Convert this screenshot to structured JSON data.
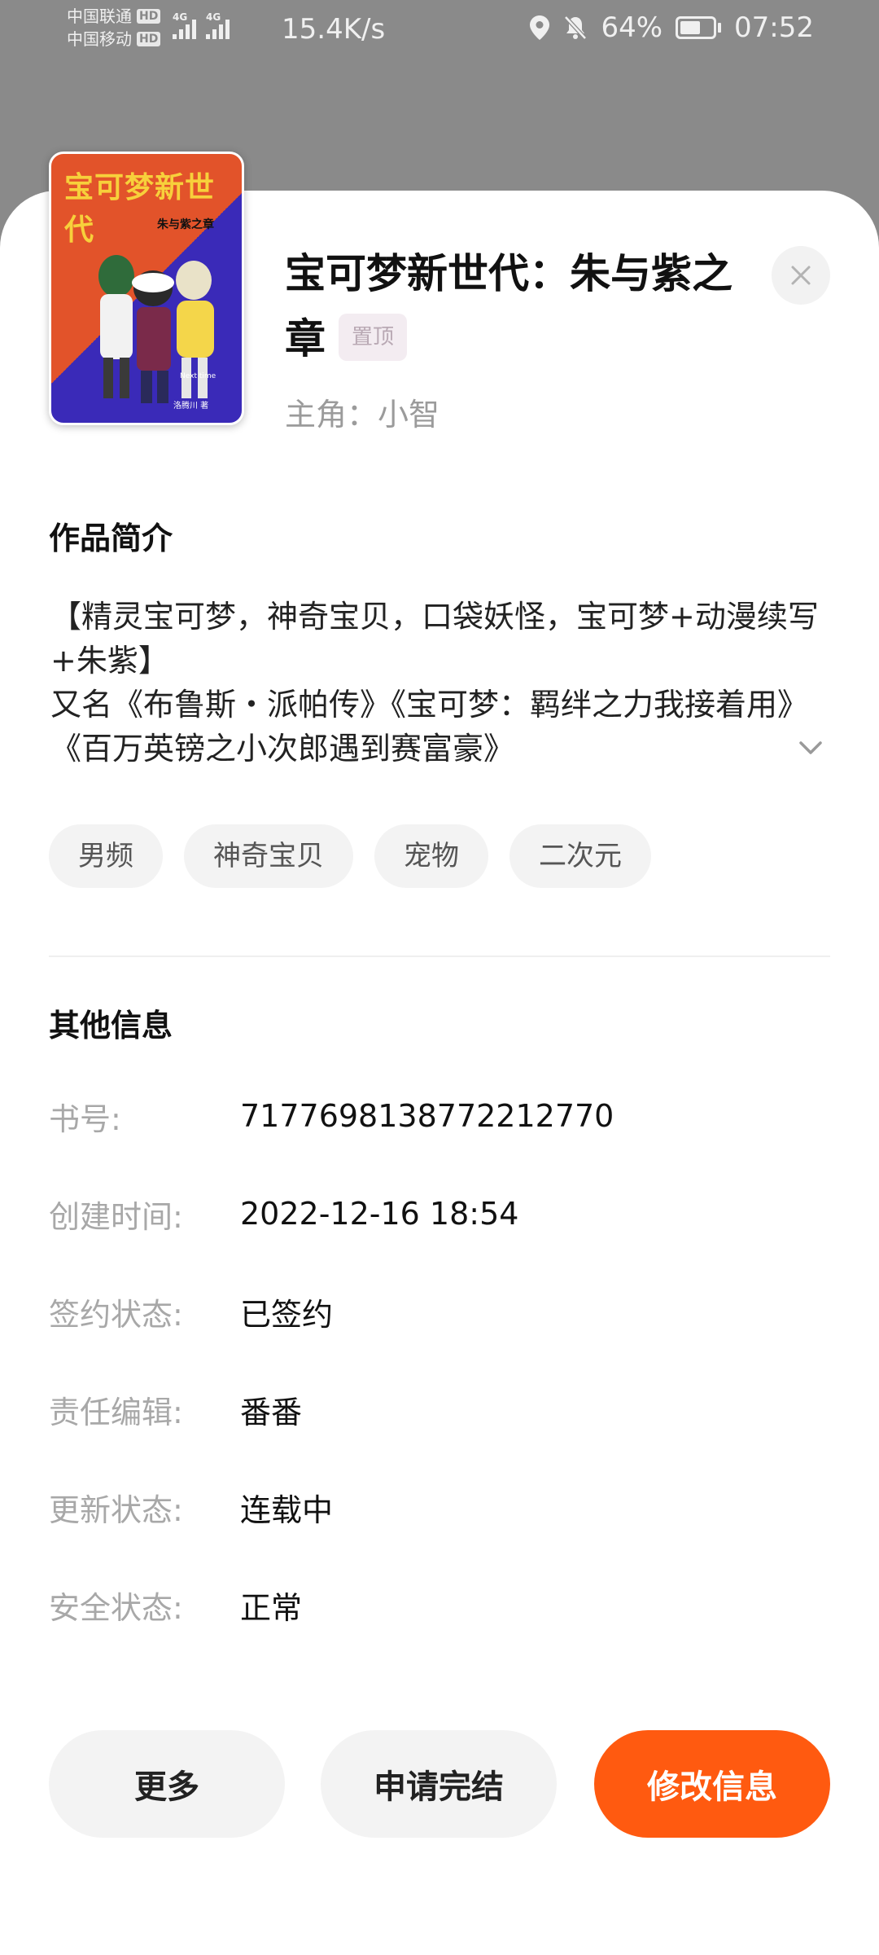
{
  "status_bar": {
    "carrier1": "中国联通",
    "carrier2": "中国移动",
    "hd": "HD",
    "network": "4G",
    "speed": "15.4K/s",
    "battery_percent": "64%",
    "battery_level": 0.64,
    "time": "07:52"
  },
  "cover": {
    "title": "宝可梦新世代",
    "subtitle": "朱与紫之章",
    "caption": "Next time",
    "author": "洛腾川 著"
  },
  "book": {
    "title": "宝可梦新世代：朱与紫之章",
    "pin_label": "置顶",
    "protagonist": "主角：小智"
  },
  "intro": {
    "heading": "作品简介",
    "line1": "【精灵宝可梦，神奇宝贝，口袋妖怪，宝可梦+动漫续写+朱紫】",
    "line2": "又名《布鲁斯・派帕传》《宝可梦：羁绊之力我接着用》《百万英镑之小次郎遇到赛富豪》"
  },
  "tags": [
    "男频",
    "神奇宝贝",
    "宠物",
    "二次元"
  ],
  "other_info": {
    "heading": "其他信息",
    "rows": [
      {
        "label": "书号:",
        "value": "7177698138772212770"
      },
      {
        "label": "创建时间:",
        "value": "2022-12-16 18:54"
      },
      {
        "label": "签约状态:",
        "value": "已签约"
      },
      {
        "label": "责任编辑:",
        "value": "番番"
      },
      {
        "label": "更新状态:",
        "value": "连载中"
      },
      {
        "label": "安全状态:",
        "value": "正常"
      }
    ]
  },
  "actions": {
    "more": "更多",
    "apply_complete": "申请完结",
    "edit_info": "修改信息"
  },
  "colors": {
    "accent": "#ff5a10",
    "overlay": "#8a8a8a"
  }
}
